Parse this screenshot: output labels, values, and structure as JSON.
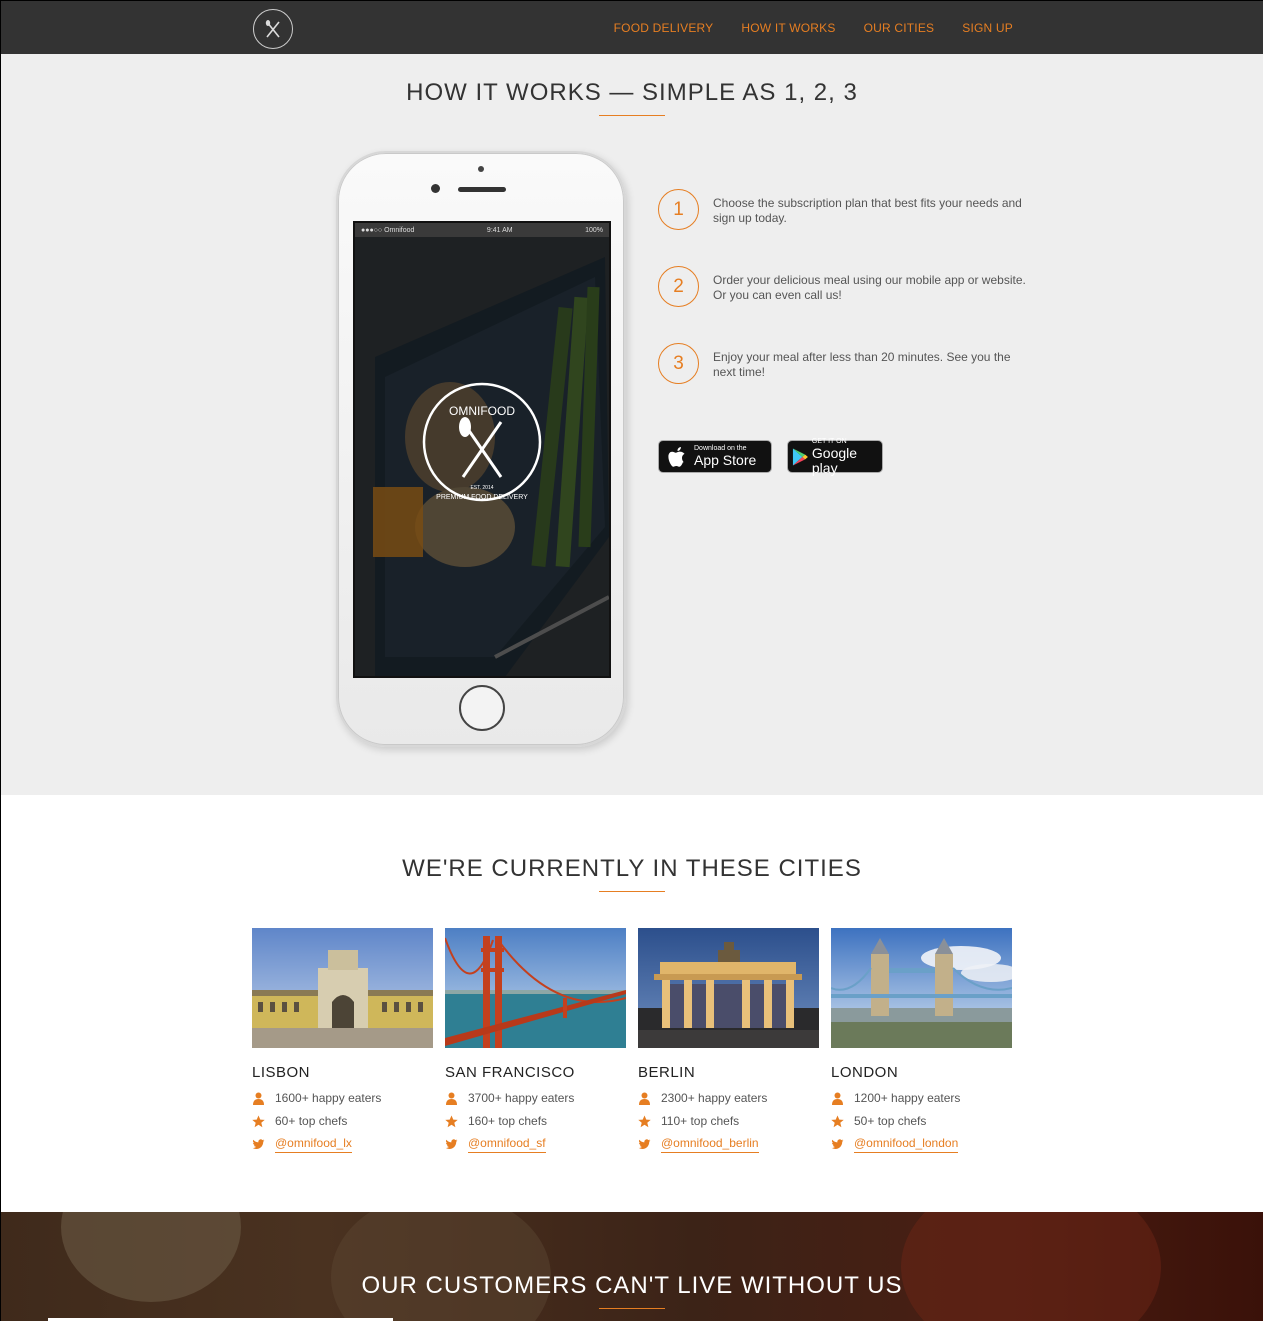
{
  "nav": {
    "links": [
      "FOOD DELIVERY",
      "HOW IT WORKS",
      "OUR CITIES",
      "SIGN UP"
    ]
  },
  "how": {
    "title": "HOW IT WORKS — SIMPLE AS 1, 2, 3",
    "phone": {
      "carrier": "●●●○○ Omnifood",
      "time": "9:41 AM",
      "battery": "100%",
      "brand": "OMNIFOOD",
      "est": "EST. 2014",
      "tagline": "PREMIUM FOOD DELIVERY"
    },
    "steps": [
      {
        "num": "1",
        "text": "Choose the subscription plan that best fits your needs and sign up today."
      },
      {
        "num": "2",
        "text": "Order your delicious meal using our mobile app or website. Or you can even call us!"
      },
      {
        "num": "3",
        "text": "Enjoy your meal after less than 20 minutes. See you the next time!"
      }
    ],
    "appstore": {
      "small": "Download on the",
      "big": "App Store"
    },
    "gplay": {
      "small": "GET IT ON",
      "big": "Google play"
    }
  },
  "cities": {
    "title": "WE'RE CURRENTLY IN THESE CITIES",
    "list": [
      {
        "name": "LISBON",
        "eaters": "1600+ happy eaters",
        "chefs": "60+ top chefs",
        "twitter": "@omnifood_lx"
      },
      {
        "name": "SAN FRANCISCO",
        "eaters": "3700+ happy eaters",
        "chefs": "160+ top chefs",
        "twitter": "@omnifood_sf"
      },
      {
        "name": "BERLIN",
        "eaters": "2300+ happy eaters",
        "chefs": "110+ top chefs",
        "twitter": "@omnifood_berlin"
      },
      {
        "name": "LONDON",
        "eaters": "1200+ happy eaters",
        "chefs": "50+ top chefs",
        "twitter": "@omnifood_london"
      }
    ]
  },
  "testimonials": {
    "title": "OUR CUSTOMERS CAN'T LIVE WITHOUT US"
  },
  "colors": {
    "accent": "#e67e22",
    "nav_bg": "#333333",
    "section_bg": "#eeeeee"
  }
}
